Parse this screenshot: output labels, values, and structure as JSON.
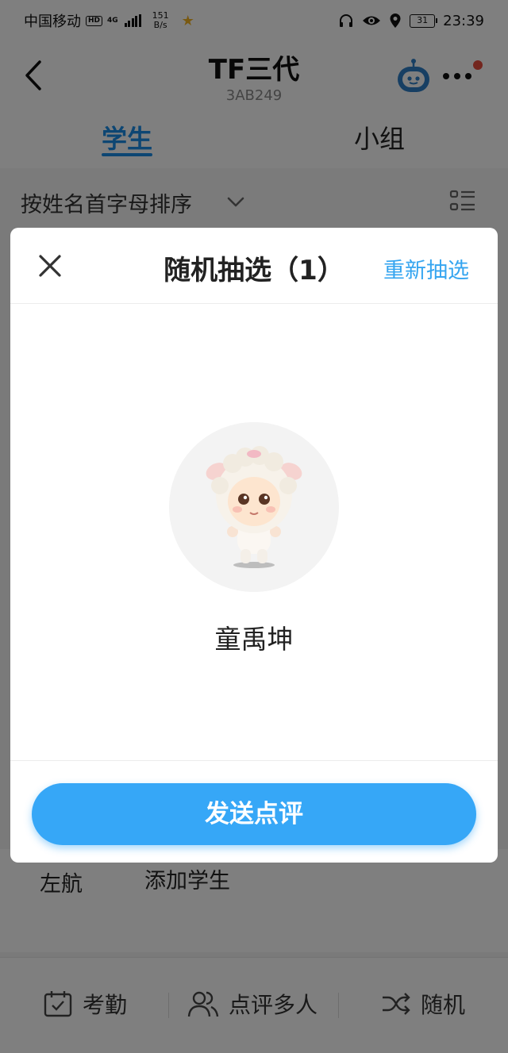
{
  "status_bar": {
    "carrier": "中国移动",
    "hd_badge": "HD",
    "net_type": "4G",
    "speed_value": "151",
    "speed_unit": "B/s",
    "battery": "31",
    "time": "23:39"
  },
  "header": {
    "title": "TF三代",
    "class_code": "3AB249",
    "tabs": [
      {
        "label": "学生",
        "active": true
      },
      {
        "label": "小组",
        "active": false
      }
    ],
    "notification_dot_color": "#e74c3c"
  },
  "sort": {
    "label": "按姓名首字母排序"
  },
  "students_visible": [
    "左航",
    "添加学生"
  ],
  "bottom_bar": {
    "items": [
      {
        "label": "考勤",
        "icon": "attendance-icon"
      },
      {
        "label": "点评多人",
        "icon": "users-icon"
      },
      {
        "label": "随机",
        "icon": "shuffle-icon"
      }
    ]
  },
  "dialog": {
    "title": "随机抽选（1）",
    "redraw_label": "重新抽选",
    "picked_student": "童禹坤",
    "avatar_icon": "lamb-costume-avatar",
    "send_label": "发送点评",
    "accent_color": "#36a7f7"
  }
}
